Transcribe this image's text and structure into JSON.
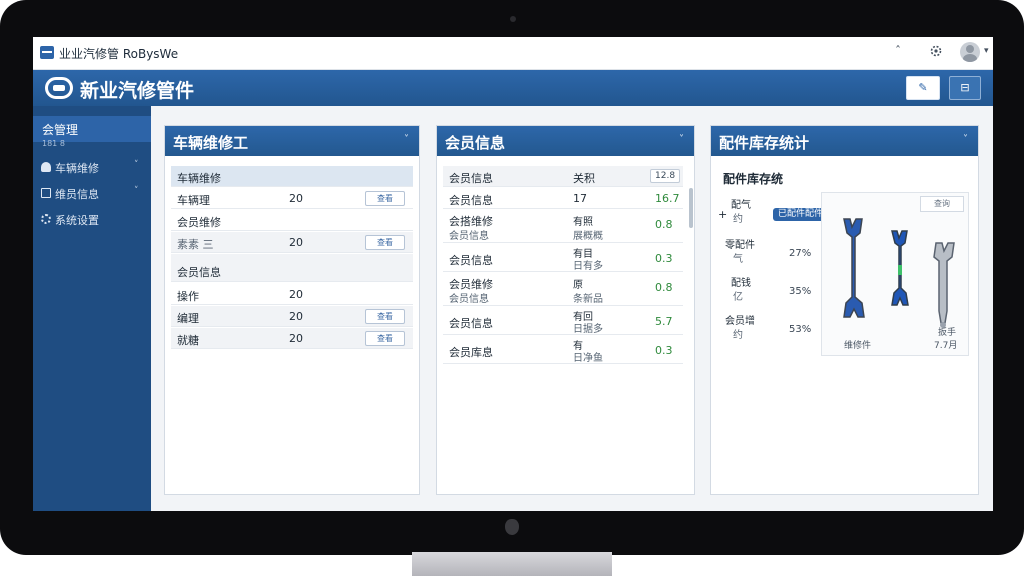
{
  "window": {
    "title": "业业汽修管 RoBysWe",
    "minimize": "ˆ",
    "settings_icon": "gear-icon"
  },
  "app": {
    "title": "新业汽修管件",
    "header_buttons": {
      "edit_label": "✎",
      "right_label": "⊟"
    }
  },
  "sidebar": {
    "items": [
      {
        "label": "会管理",
        "icon": "home-icon"
      },
      {
        "label": "车辆维修",
        "icon": "user-icon"
      },
      {
        "label": "维员信息",
        "icon": "card-icon"
      },
      {
        "label": "系统设置",
        "icon": "gear-icon"
      }
    ],
    "sub_caption": "181 8"
  },
  "panels": {
    "repair": {
      "title": "车辆维修工",
      "header": "车辆维修",
      "rows": [
        {
          "name": "车辆理",
          "value": "20",
          "button": "查看"
        },
        {
          "name": "会员维修",
          "value": "",
          "button": ""
        },
        {
          "name": "素素 三",
          "value": "20",
          "button": "查看"
        },
        {
          "name": "会员信息",
          "value": "",
          "button": ""
        },
        {
          "name": "操作",
          "value": "20",
          "button": ""
        },
        {
          "name": "编理",
          "value": "20",
          "button": "查看"
        },
        {
          "name": "就糖",
          "value": "20",
          "button": "查看"
        }
      ]
    },
    "member": {
      "title": "会员信息",
      "header": {
        "col1": "会员信息",
        "col2": "关积",
        "col3": "12.8"
      },
      "rows": [
        {
          "name": "会员信息",
          "sub": "",
          "col2": "17",
          "col2_sub": "",
          "value": "16.7"
        },
        {
          "name": "会搭维修",
          "sub": "会员信息",
          "col2": "有照",
          "col2_sub": "展概概",
          "value": "0.8"
        },
        {
          "name": "会员信息",
          "sub": "",
          "col2": "有目",
          "col2_sub": "日有多",
          "value": "0.3"
        },
        {
          "name": "会员维修",
          "sub": "会员信息",
          "col2": "原",
          "col2_sub": "条新品",
          "value": "0.8"
        },
        {
          "name": "会员信息",
          "sub": "",
          "col2": "有回",
          "col2_sub": "日据多",
          "value": "5.7"
        },
        {
          "name": "会员库息",
          "sub": "",
          "col2": "有",
          "col2_sub": "日净鱼",
          "value": "0.3"
        }
      ]
    },
    "inventory": {
      "title": "配件库存统计",
      "subtitle": "配件库存统",
      "plus": "+",
      "labels": [
        {
          "name": "配气",
          "value": "约"
        },
        {
          "name": "零配件",
          "value": "气"
        },
        {
          "name": "配钱",
          "value": "亿"
        },
        {
          "name": "会员增",
          "value": "约"
        }
      ],
      "badge": "已配件配件",
      "percents": [
        "27%",
        "35%",
        "53%"
      ],
      "tool_card": {
        "search": "查询",
        "captions": [
          "维修件",
          "扳手",
          "7.7月"
        ]
      }
    }
  },
  "colors": {
    "brand": "#2d64a8",
    "sidebar": "#1f4d82",
    "green": "#2f8a3c"
  }
}
